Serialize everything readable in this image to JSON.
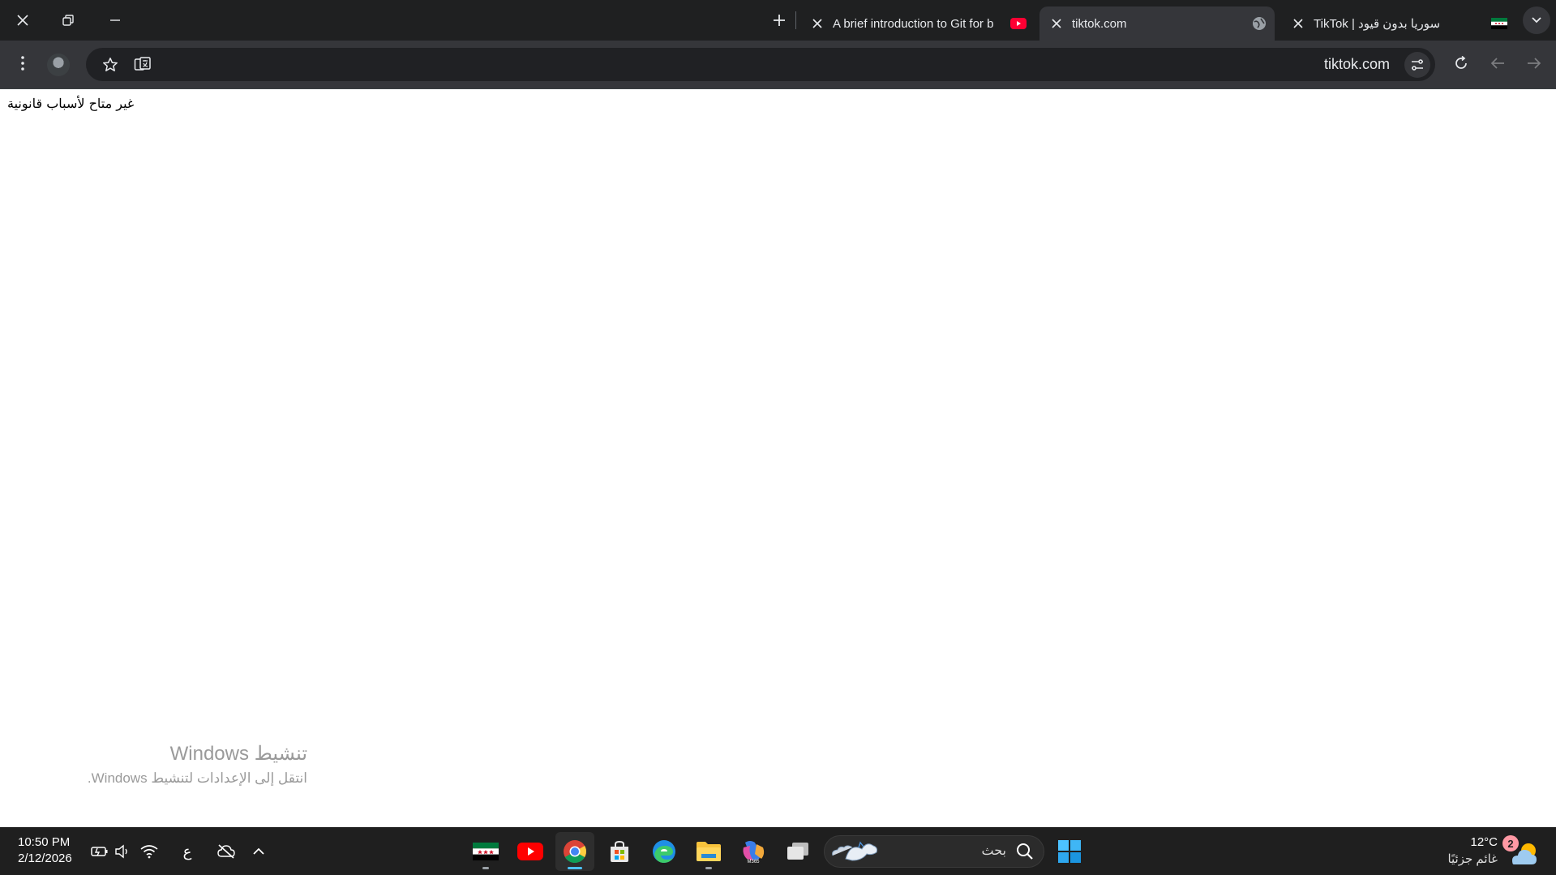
{
  "browser": {
    "tabs": [
      {
        "title": "A brief introduction to Git for b",
        "favicon": "youtube-icon",
        "active": false
      },
      {
        "title": "tiktok.com",
        "favicon": "globe-icon",
        "active": true
      },
      {
        "title": "TikTok | سوريا بدون قيود",
        "favicon": "syria-flag-icon",
        "active": false
      }
    ],
    "window_controls": [
      "close-icon",
      "restore-icon",
      "minimize-icon"
    ],
    "new_tab_icon": "plus-icon",
    "tab_list_icon": "chevron-down-icon"
  },
  "toolbar": {
    "url": "tiktok.com",
    "menu_icon": "more-vertical-icon",
    "bookmark_icon": "star-icon",
    "translate_icon": "translate-icon",
    "site_info_icon": "tune-icon",
    "reload_icon": "reload-icon",
    "back_icon": "arrow-left-icon",
    "forward_icon": "arrow-right-icon"
  },
  "page": {
    "message": "غير متاح لأسباب قانونية"
  },
  "activation": {
    "title": "تنشيط Windows",
    "subtitle": "انتقل إلى الإعدادات لتنشيط Windows."
  },
  "taskbar": {
    "time": "10:50 PM",
    "date": "2/12/2026",
    "language": "ع",
    "search_placeholder": "بحث",
    "weather_temp": "12°C",
    "weather_desc": "غائم جزئيًا",
    "weather_badge": "2",
    "apps": [
      "syria-flag-app",
      "youtube-app",
      "chrome-app",
      "store-app",
      "edge-app",
      "file-explorer-app",
      "m365-app",
      "task-view-app"
    ],
    "colors": {
      "taskbar_bg": "#1f1f1f",
      "active_indicator": "#4cc2ff",
      "chrome_dark": "#35363a"
    }
  }
}
